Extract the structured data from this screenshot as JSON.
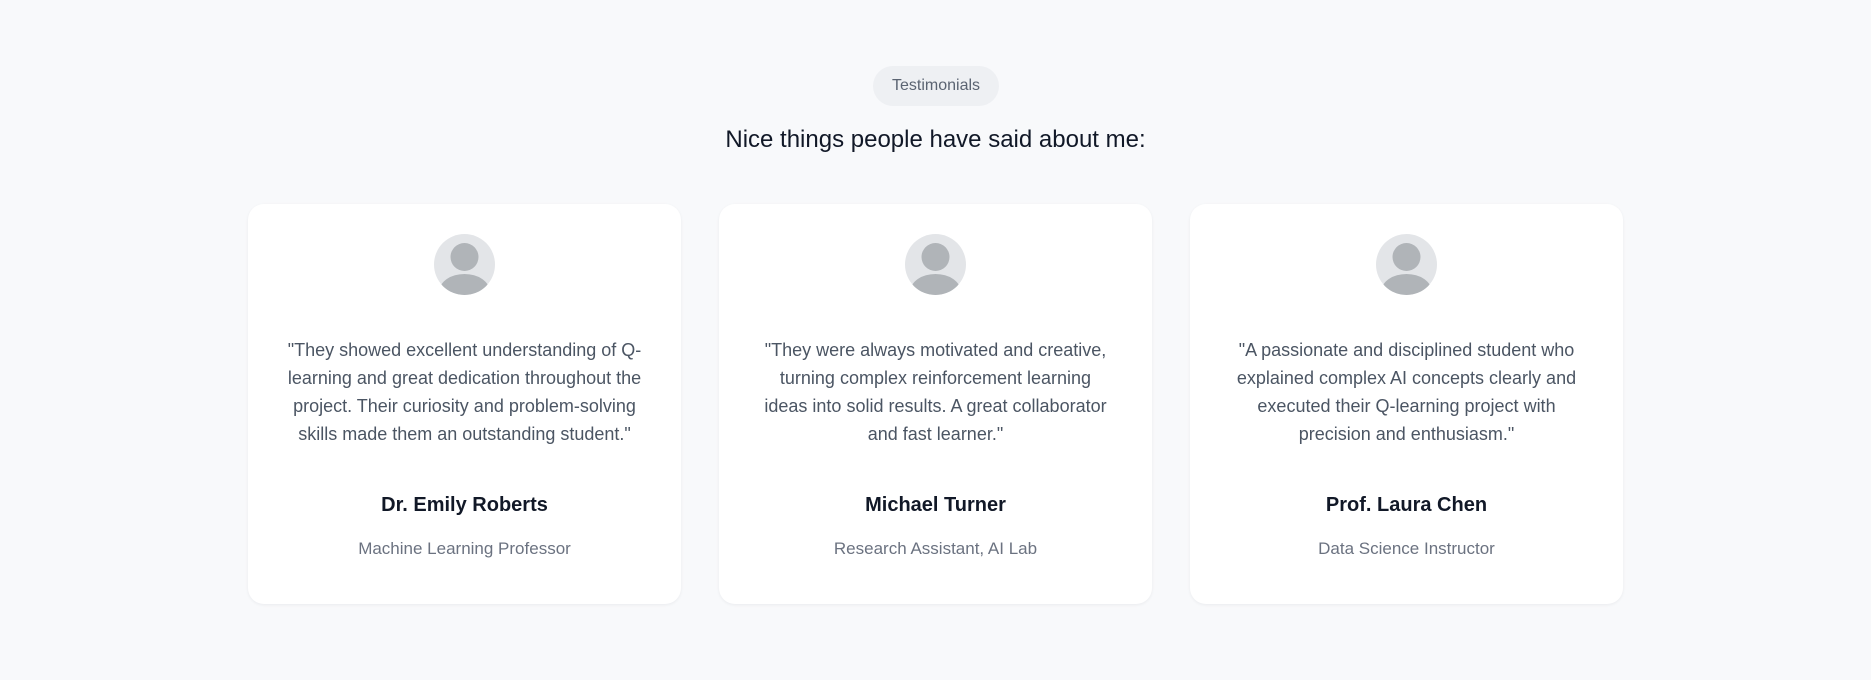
{
  "section": {
    "badge": "Testimonials",
    "heading": "Nice things people have said about me:"
  },
  "testimonials": [
    {
      "avatar_icon": "user-silhouette-icon",
      "quote": "\"They showed excellent understanding of Q-learning and great dedication throughout the project. Their curiosity and problem-solving skills made them an outstanding student.\"",
      "name": "Dr. Emily Roberts",
      "role": "Machine Learning Professor"
    },
    {
      "avatar_icon": "user-silhouette-icon",
      "quote": "\"They were always motivated and creative, turning complex reinforcement learning ideas into solid results. A great collaborator and fast learner.\"",
      "name": "Michael Turner",
      "role": "Research Assistant, AI Lab"
    },
    {
      "avatar_icon": "user-silhouette-icon",
      "quote": "\"A passionate and disciplined student who explained complex AI concepts clearly and executed their Q-learning project with precision and enthusiasm.\"",
      "name": "Prof. Laura Chen",
      "role": "Data Science Instructor"
    }
  ],
  "colors": {
    "page_background": "#f8f9fb",
    "card_background": "#ffffff",
    "badge_background": "#eef0f3",
    "avatar_background": "#e3e5e8",
    "avatar_figure": "#b0b4b8",
    "heading_text": "#111827",
    "quote_text": "#4b5563",
    "role_text": "#6b7280"
  }
}
